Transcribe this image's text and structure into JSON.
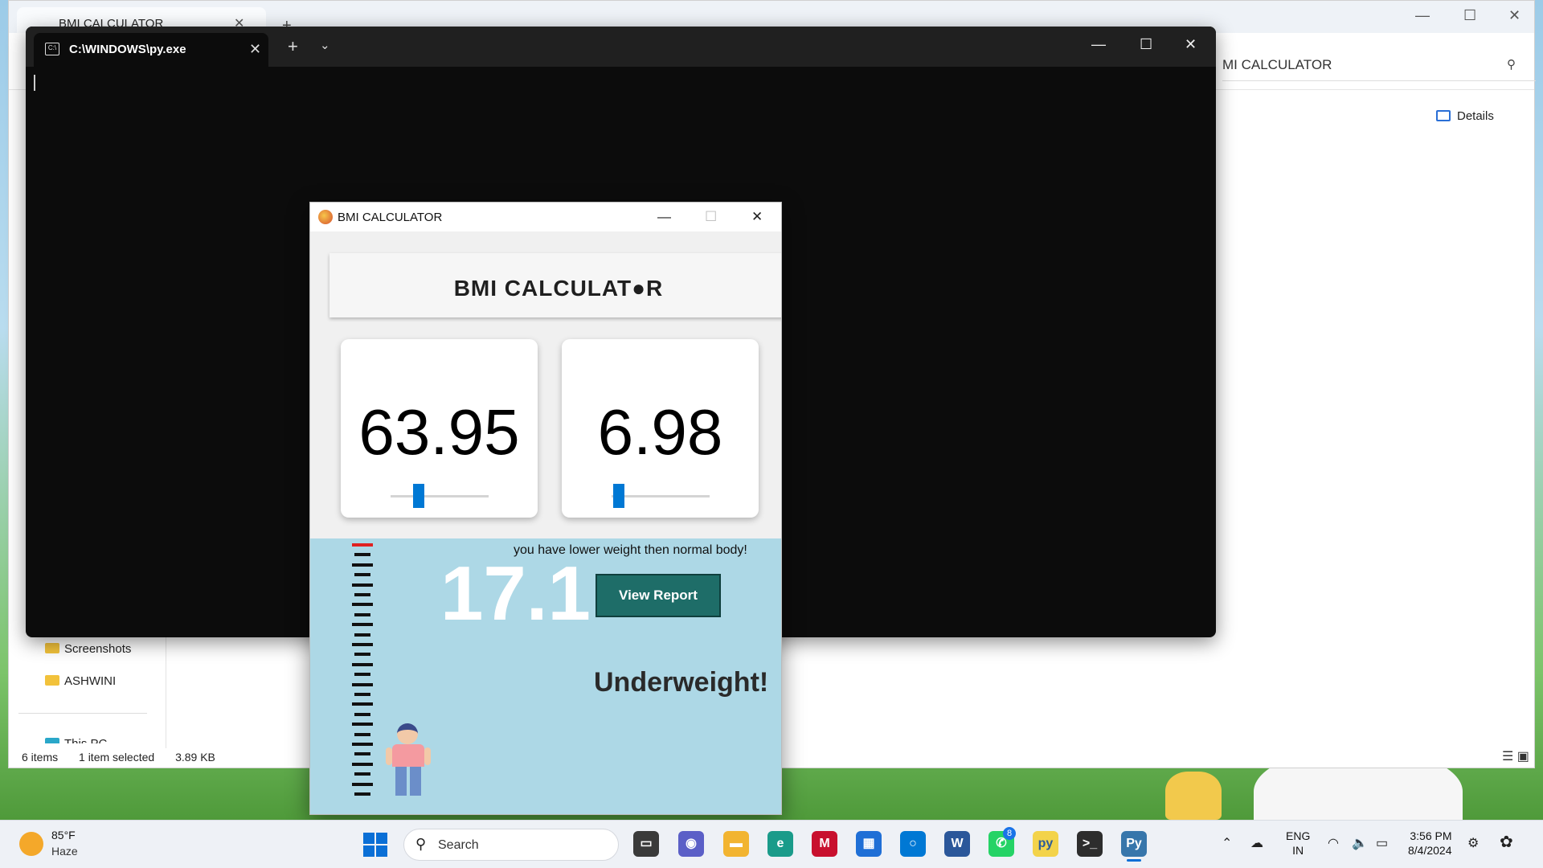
{
  "explorer": {
    "tab_title": "BMI CALCULATOR",
    "address": "MI CALCULATOR",
    "details_label": "Details",
    "nav": [
      "Screenshots",
      "ASHWINI",
      "This PC"
    ],
    "status": {
      "items": "6 items",
      "selected": "1 item selected",
      "size": "3.89 KB"
    }
  },
  "terminal": {
    "tab_title": "C:\\WINDOWS\\py.exe",
    "new_tab": "+",
    "dropdown": "⌄",
    "controls": {
      "minimize": "—",
      "maximize": "☐",
      "close": "✕"
    }
  },
  "bmi_window": {
    "title": "BMI CALCULATOR",
    "heading": "BMI CALCULAT●R",
    "height_value": "63.95",
    "weight_value": "6.98",
    "height_slider_fraction": 0.26,
    "weight_slider_fraction": 0.02,
    "message": "you have lower weight then normal body!",
    "bmi_value": "17.1",
    "view_report_label": "View Report",
    "category": "Underweight!",
    "controls": {
      "minimize": "—",
      "maximize": "☐",
      "close": "✕"
    }
  },
  "taskbar": {
    "weather_temp": "85°F",
    "weather_condition": "Haze",
    "search_placeholder": "Search",
    "whatsapp_badge": "8",
    "language_top": "ENG",
    "language_bottom": "IN",
    "time": "3:56 PM",
    "date": "8/4/2024"
  },
  "colors": {
    "accent": "#0078d4",
    "result_panel": "#add8e6",
    "view_report_button": "#1e6d68"
  }
}
